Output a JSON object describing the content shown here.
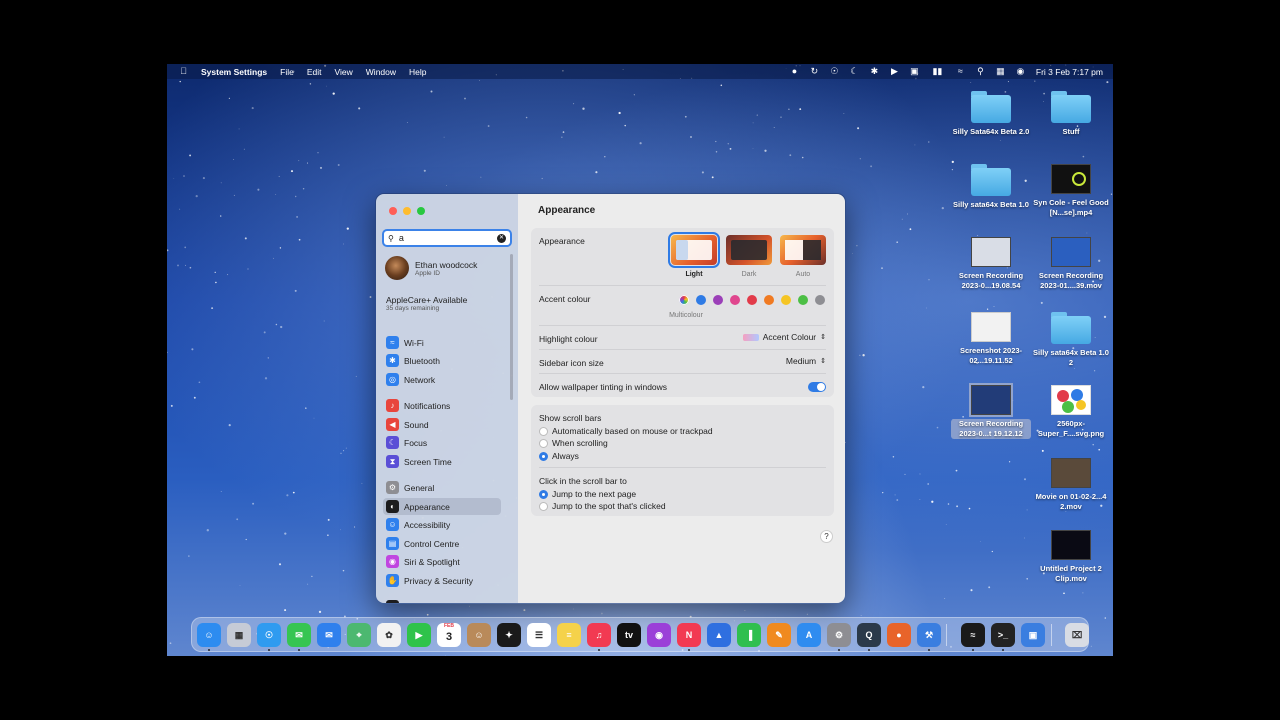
{
  "menubar": {
    "app_name": "System Settings",
    "menus": [
      "File",
      "Edit",
      "View",
      "Window",
      "Help"
    ],
    "datetime": "Fri 3 Feb  7:17 pm"
  },
  "desktop_icons": [
    {
      "label": "Silly Sata64x Beta 2.0",
      "kind": "folder"
    },
    {
      "label": "Stuff",
      "kind": "folder"
    },
    {
      "label": "Silly sata64x Beta 1.0",
      "kind": "folder"
    },
    {
      "label": "Syn Cole - Feel Good [N...se].mp4",
      "kind": "video"
    },
    {
      "label": "Screen Recording 2023-0...19.08.54",
      "kind": "recording"
    },
    {
      "label": "Screen Recording 2023-01....39.mov",
      "kind": "recording"
    },
    {
      "label": "Screenshot 2023-02...19.11.52",
      "kind": "screenshot"
    },
    {
      "label": "Silly sata64x Beta 1.0 2",
      "kind": "folder"
    },
    {
      "label": "Screen Recording 2023-0...t 19.12.12",
      "kind": "recording"
    },
    {
      "label": "2560px-Super_F....svg.png",
      "kind": "image"
    },
    {
      "label": "Movie on 01-02-2...4 2.mov",
      "kind": "video"
    },
    {
      "label": "Untitled Project 2 Clip.mov",
      "kind": "video"
    }
  ],
  "sidebar": {
    "search_value": "a",
    "user_name": "Ethan woodcock",
    "user_sub": "Apple ID",
    "applecare_title": "AppleCare+ Available",
    "applecare_sub": "35 days remaining",
    "items": [
      {
        "label": "Wi-Fi",
        "icon": "wifi-icon",
        "color": "#2f80ed"
      },
      {
        "label": "Bluetooth",
        "icon": "bluetooth-icon",
        "color": "#2f80ed"
      },
      {
        "label": "Network",
        "icon": "globe-icon",
        "color": "#2f80ed"
      },
      {
        "label": "Notifications",
        "icon": "bell-icon",
        "color": "#e8453c"
      },
      {
        "label": "Sound",
        "icon": "speaker-icon",
        "color": "#e8453c"
      },
      {
        "label": "Focus",
        "icon": "moon-icon",
        "color": "#5a4fd6"
      },
      {
        "label": "Screen Time",
        "icon": "hourglass-icon",
        "color": "#5a4fd6"
      },
      {
        "label": "General",
        "icon": "gear-icon",
        "color": "#8e8e93"
      },
      {
        "label": "Appearance",
        "icon": "appearance-icon",
        "color": "#1c1c1e"
      },
      {
        "label": "Accessibility",
        "icon": "accessibility-icon",
        "color": "#2f80ed"
      },
      {
        "label": "Control Centre",
        "icon": "control-centre-icon",
        "color": "#2f80ed"
      },
      {
        "label": "Siri & Spotlight",
        "icon": "siri-icon",
        "color": "#c046e0"
      },
      {
        "label": "Privacy & Security",
        "icon": "hand-icon",
        "color": "#2f80ed"
      },
      {
        "label": "Desktop & Dock",
        "icon": "dock-icon",
        "color": "#1c1c1e"
      }
    ]
  },
  "content": {
    "title": "Appearance",
    "appearance_label": "Appearance",
    "modes": [
      "Light",
      "Dark",
      "Auto"
    ],
    "selected_mode": "Light",
    "accent_label": "Accent colour",
    "accent_selected_name": "Multicolour",
    "accent_colors": [
      "#9b59ff",
      "#2f7be5",
      "#9b3fb8",
      "#e0468e",
      "#e23b4a",
      "#f07a22",
      "#f5c524",
      "#4cbf45",
      "#8e8e93"
    ],
    "highlight_label": "Highlight colour",
    "highlight_value": "Accent Colour",
    "sidebar_icon_label": "Sidebar icon size",
    "sidebar_icon_value": "Medium",
    "tinting_label": "Allow wallpaper tinting in windows",
    "tinting_on": true,
    "scroll_label": "Show scroll bars",
    "scroll_options": [
      "Automatically based on mouse or trackpad",
      "When scrolling",
      "Always"
    ],
    "scroll_selected": "Always",
    "click_label": "Click in the scroll bar to",
    "click_options": [
      "Jump to the next page",
      "Jump to the spot that's clicked"
    ],
    "click_selected": "Jump to the next page",
    "help": "?"
  },
  "dock": {
    "calendar_month": "FEB",
    "calendar_day": "3",
    "apps": [
      "Finder",
      "Launchpad",
      "Safari",
      "Messages",
      "Mail",
      "Maps",
      "Photos",
      "FaceTime",
      "Calendar",
      "Contacts",
      "Final Cut Pro",
      "Reminders",
      "Notes",
      "Music",
      "TV",
      "Podcasts",
      "News",
      "Keynote",
      "Numbers",
      "Pages",
      "App Store",
      "System Settings",
      "QuickTime",
      "Firefox",
      "Xcode",
      "Spotify",
      "Terminal",
      "Preview",
      "Trash"
    ]
  }
}
